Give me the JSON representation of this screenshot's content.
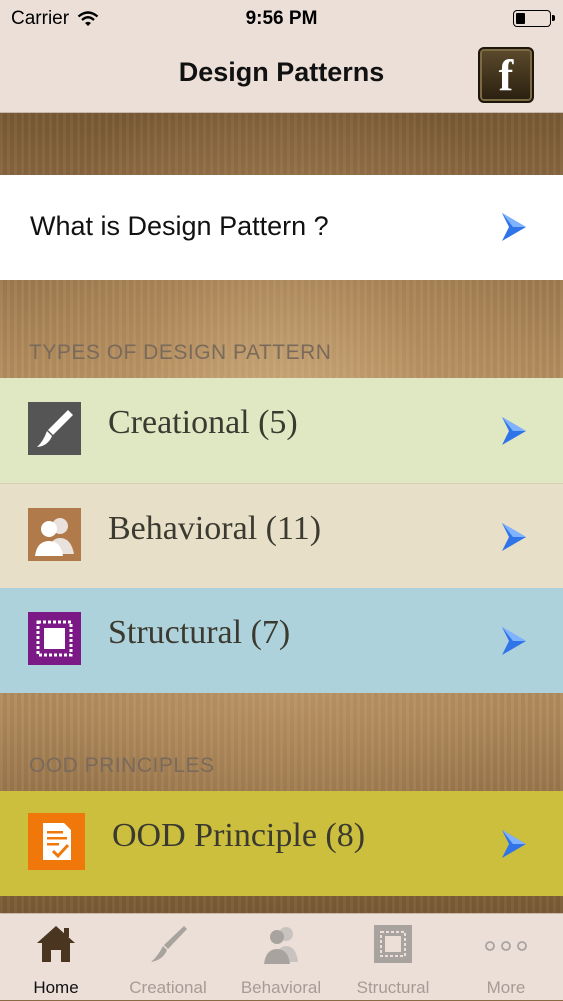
{
  "status_bar": {
    "carrier": "Carrier",
    "time": "9:56 PM"
  },
  "nav": {
    "title": "Design Patterns",
    "facebook_label": "f"
  },
  "intro": {
    "label": "What is Design Pattern ?"
  },
  "sections": {
    "types_header": "TYPES OF DESIGN PATTERN",
    "ood_header": "OOD PRINCIPLES"
  },
  "categories": [
    {
      "label": "Creational (5)",
      "color": "#e0e8c3",
      "icon": "paintbrush-icon"
    },
    {
      "label": "Behavioral (11)",
      "color": "#e8dfc8",
      "icon": "users-icon"
    },
    {
      "label": "Structural (7)",
      "color": "#aed2db",
      "icon": "frame-icon"
    }
  ],
  "ood": {
    "label": "OOD Principle (8)",
    "color": "#cdbf3e",
    "icon": "document-check-icon"
  },
  "tabs": [
    {
      "label": "Home",
      "icon": "home-icon"
    },
    {
      "label": "Creational",
      "icon": "paintbrush-icon"
    },
    {
      "label": "Behavioral",
      "icon": "users-icon"
    },
    {
      "label": "Structural",
      "icon": "frame-icon"
    },
    {
      "label": "More",
      "icon": "more-dots-icon"
    }
  ]
}
